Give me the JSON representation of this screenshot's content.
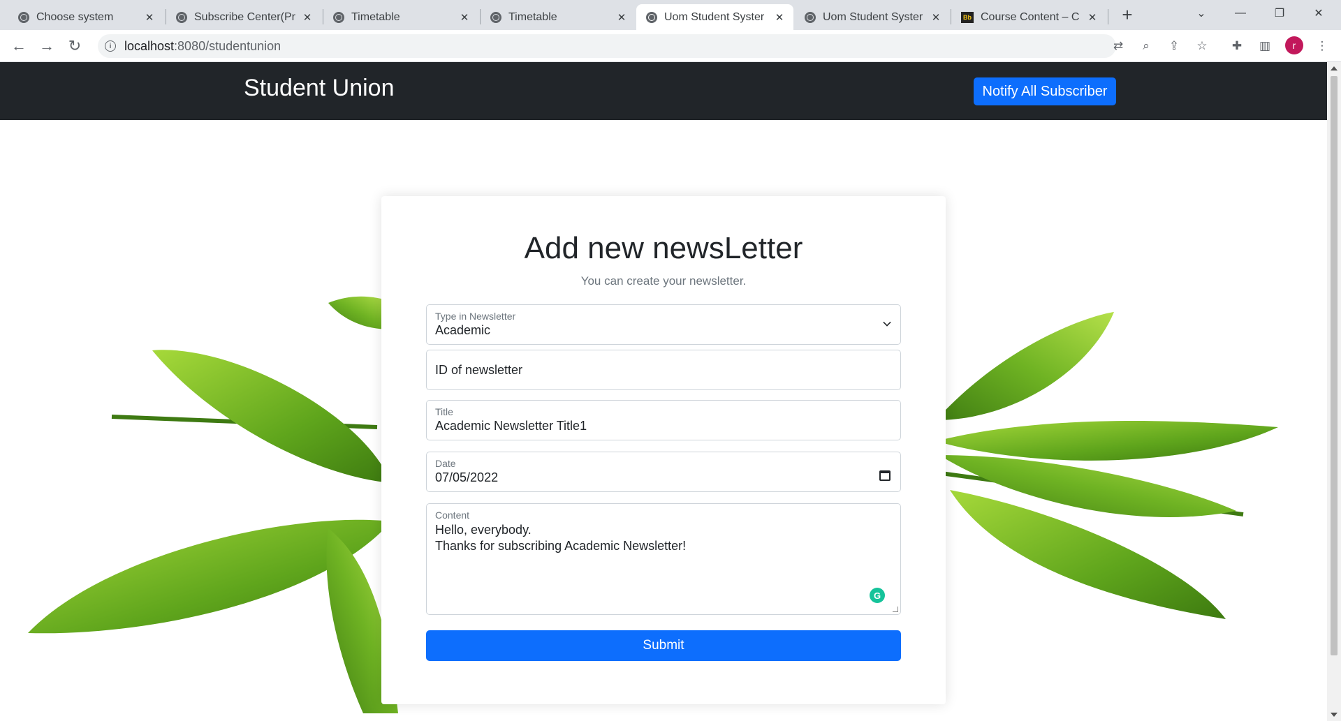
{
  "browser": {
    "tabs": [
      {
        "title": "Choose system",
        "icon": "globe-icon",
        "active": false
      },
      {
        "title": "Subscribe Center(Pr",
        "icon": "globe-icon",
        "active": false
      },
      {
        "title": "Timetable",
        "icon": "globe-icon",
        "active": false
      },
      {
        "title": "Timetable",
        "icon": "globe-icon",
        "active": false
      },
      {
        "title": "Uom Student Syster",
        "icon": "globe-icon",
        "active": true
      },
      {
        "title": "Uom Student Syster",
        "icon": "globe-icon",
        "active": false
      },
      {
        "title": "Course Content – C",
        "icon": "blackboard-icon",
        "active": false
      }
    ],
    "url_host": "localhost",
    "url_path": ":8080/studentunion",
    "profile_initial": "r"
  },
  "navbar": {
    "brand": "Student Union",
    "notify_button": "Notify All Subscriber"
  },
  "form": {
    "title": "Add new newsLetter",
    "subtitle": "You can create your newsletter.",
    "type_label": "Type in Newsletter",
    "type_value": "Academic",
    "id_placeholder": "ID of newsletter",
    "title_label": "Title",
    "title_value": "Academic Newsletter Title1",
    "date_label": "Date",
    "date_value": "07/05/2022",
    "content_label": "Content",
    "content_value": "Hello, everybody.\nThanks for subscribing Academic Newsletter!",
    "submit_label": "Submit"
  },
  "colors": {
    "navbar_bg": "#212529",
    "primary": "#0d6efd",
    "leaf_green": "#7cc42a"
  }
}
